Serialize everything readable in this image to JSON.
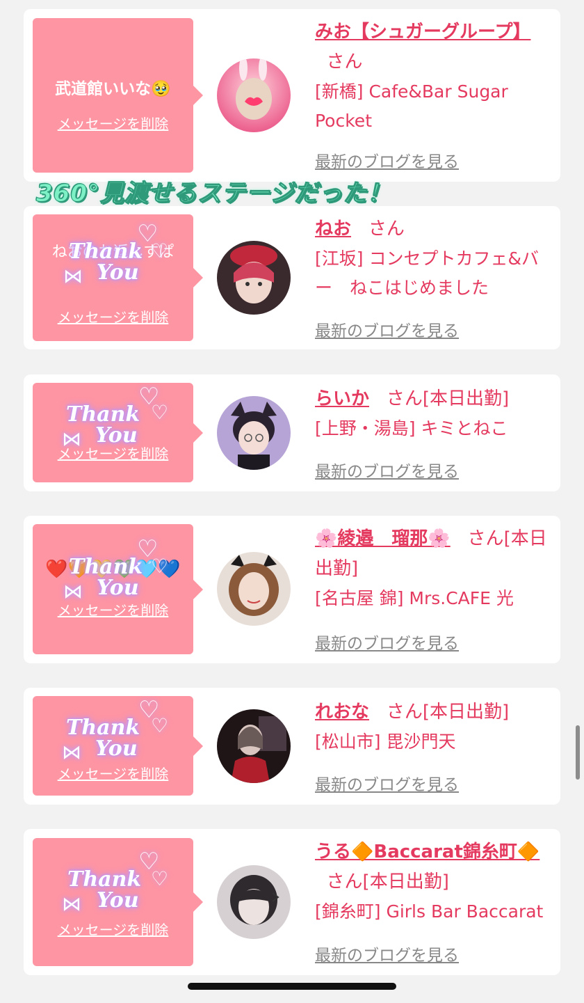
{
  "overlay_caption": "360°見渡せるステージだった！",
  "delete_label": "メッセージを削除",
  "blog_label": "最新のブログを見る",
  "honorific": "さん",
  "sticker": {
    "word1": "Thank",
    "word2": "You"
  },
  "cards": [
    {
      "message": "武道館いいな🥹",
      "name": "みお【シュガーグループ】",
      "status": "",
      "shop": "[新橋] Cafe&Bar Sugar Pocket",
      "avatar_icon": "avatar-photo"
    },
    {
      "message": "ねおのお返しすぱ",
      "name": "ねお",
      "status": "",
      "shop": "[江坂] コンセプトカフェ&バー　ねこはじめました",
      "avatar_icon": "avatar-photo"
    },
    {
      "message": "",
      "name": "らいか",
      "status": "[本日出勤]",
      "shop": "[上野・湯島] キミとねこ",
      "avatar_icon": "avatar-photo"
    },
    {
      "message": "❤️🧡💛💚🩵💙",
      "name": "🌸綾邉　瑠那🌸",
      "status": "[本日出勤]",
      "shop": "[名古屋 錦] Mrs.CAFE 光",
      "avatar_icon": "avatar-photo"
    },
    {
      "message": "",
      "name": "れおな",
      "status": "[本日出勤]",
      "shop": "[松山市] 毘沙門天",
      "avatar_icon": "avatar-photo"
    },
    {
      "message": "",
      "name": "うる🔶Baccarat錦糸町🔶",
      "status": "[本日出勤]",
      "shop": "[錦糸町] Girls Bar Baccarat",
      "avatar_icon": "avatar-photo"
    }
  ],
  "colors": {
    "accent": "#e53a5f",
    "bubble": "#fe95a3",
    "caption": "#7ef0c6"
  }
}
